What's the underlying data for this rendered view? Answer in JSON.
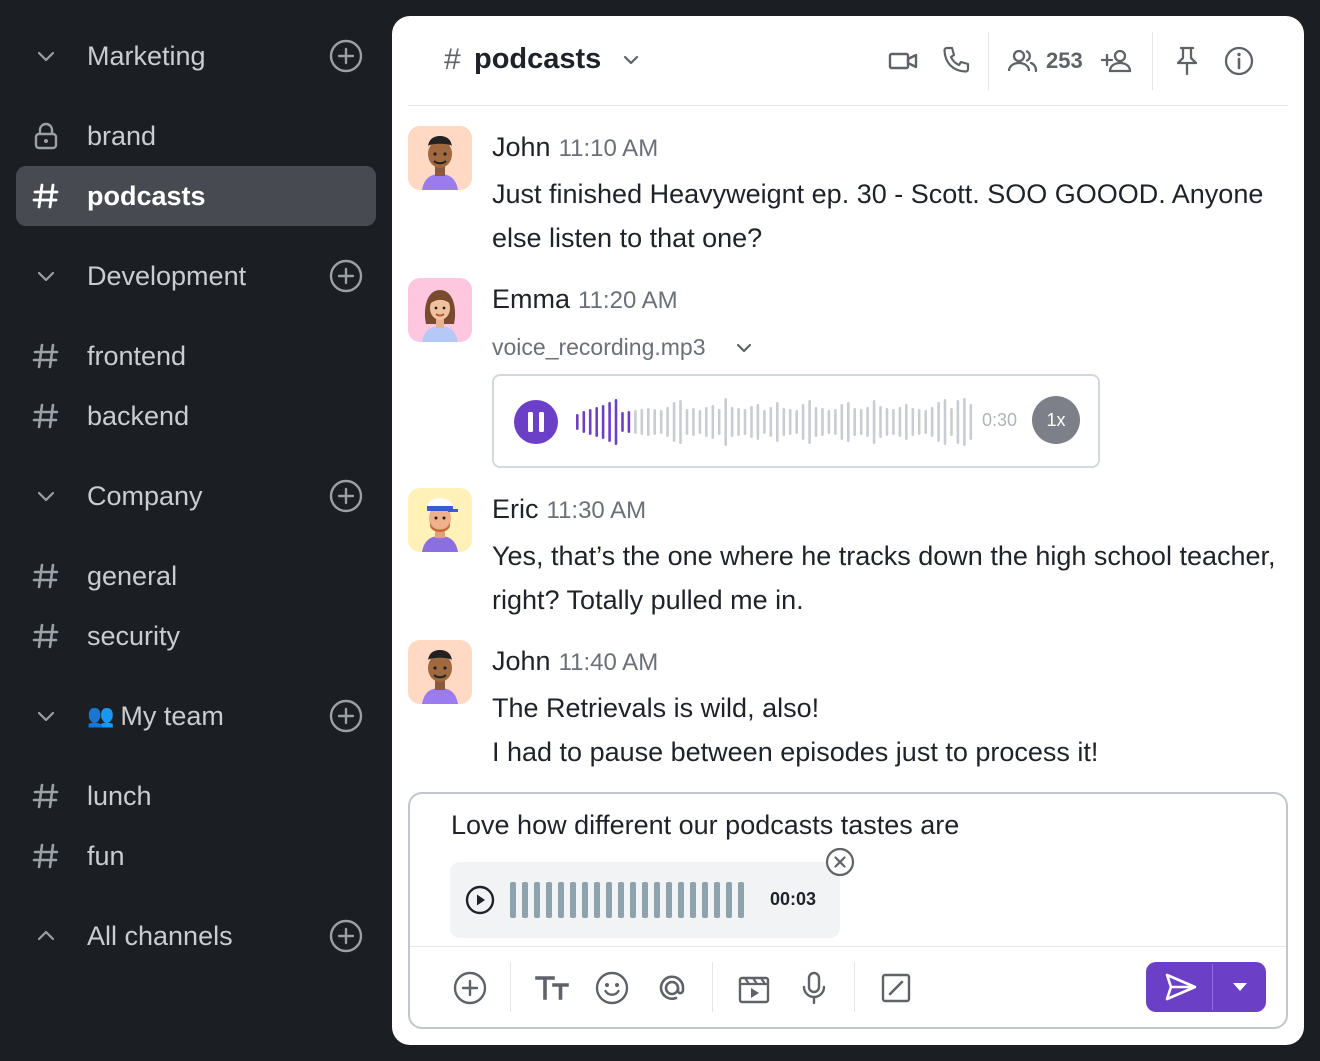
{
  "sidebar": {
    "groups": {
      "marketing": "Marketing",
      "development": "Development",
      "company": "Company",
      "my_team_emoji": "👥",
      "my_team": "My team",
      "all_channels": "All channels"
    },
    "channels": {
      "brand": "brand",
      "podcasts": "podcasts",
      "frontend": "frontend",
      "backend": "backend",
      "general": "general",
      "security": "security",
      "lunch": "lunch",
      "fun": "fun"
    },
    "hash": "#"
  },
  "header": {
    "hash": "#",
    "channel": "podcasts",
    "member_count": "253"
  },
  "messages": [
    {
      "author": "John",
      "time": "11:10 AM",
      "text": "Just finished Heavyweignt ep. 30 - Scott. SOO GOOOD. Anyone else listen to that one?"
    },
    {
      "author": "Emma",
      "time": "11:20 AM",
      "file_name": "voice_recording.mp3",
      "audio_duration": "0:30",
      "speed": "1x",
      "progress": 0.13
    },
    {
      "author": "Eric",
      "time": "11:30 AM",
      "text": "Yes, that’s the one where he tracks down the high school teacher, right? Totally pulled me in."
    },
    {
      "author": "John",
      "time": "11:40 AM",
      "text_line1": "The Retrievals is wild, also!",
      "text_line2": "I had to pause between episodes just to process it!"
    }
  ],
  "composer": {
    "text": "Love how different our podcasts tastes are",
    "recording_time": "00:03"
  },
  "colors": {
    "accent": "#6c3fc7",
    "sidebar_bg": "#1b1f23",
    "active_channel_bg": "#474b51"
  }
}
